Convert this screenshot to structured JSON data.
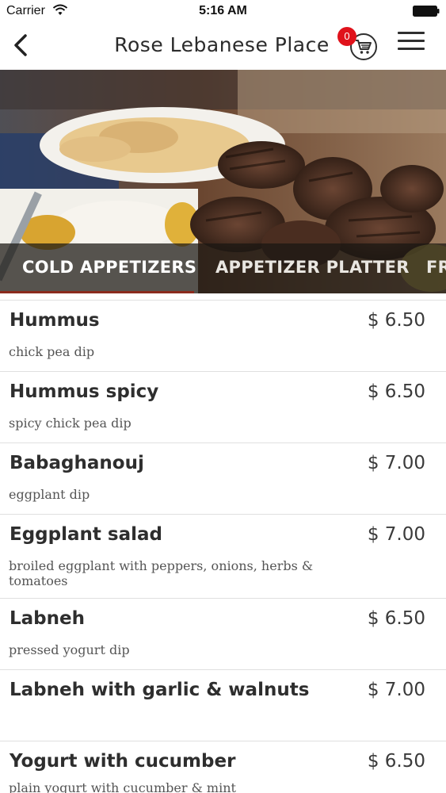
{
  "status_bar": {
    "carrier": "Carrier",
    "time": "5:16 AM"
  },
  "nav": {
    "title": "Rose Lebanese Place",
    "cart_count": "0"
  },
  "tabs": [
    {
      "label": "COLD APPETIZERS",
      "active": true
    },
    {
      "label": "APPETIZER PLATTER",
      "active": false
    },
    {
      "label": "FR",
      "active": false
    }
  ],
  "menu_items": [
    {
      "name": "Hummus",
      "price": "$ 6.50",
      "description": "chick pea dip"
    },
    {
      "name": "Hummus spicy",
      "price": "$ 6.50",
      "description": "spicy chick pea dip"
    },
    {
      "name": "Babaghanouj",
      "price": "$ 7.00",
      "description": "eggplant dip"
    },
    {
      "name": "Eggplant salad",
      "price": "$ 7.00",
      "description": "broiled eggplant with peppers, onions, herbs & tomatoes"
    },
    {
      "name": "Labneh",
      "price": "$ 6.50",
      "description": "pressed yogurt dip"
    },
    {
      "name": "Labneh with garlic & walnuts",
      "price": "$ 7.00",
      "description": ""
    },
    {
      "name": "Yogurt with cucumber",
      "price": "$ 6.50",
      "description": "plain yogurt with cucumber & mint"
    }
  ],
  "colors": {
    "badge": "#e0121b",
    "tab_underline": "#8b2b1d",
    "text": "#2e2e2e"
  }
}
